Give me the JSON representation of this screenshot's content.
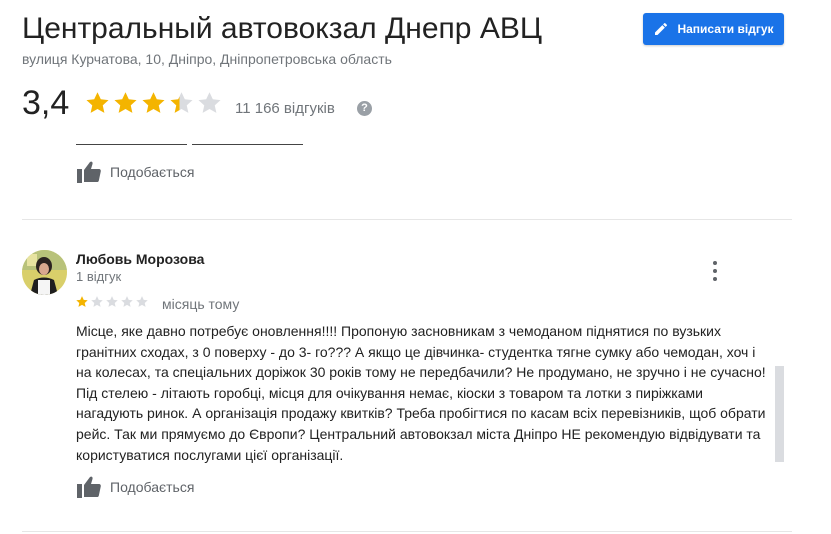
{
  "place": {
    "title": "Центральный автовокзал Днепр АВЦ",
    "address": "вулиця Курчатова, 10, Дніпро, Дніпропетровська область",
    "rating": "3,4",
    "rating_value": 3.4,
    "review_count": "11 166 відгуків",
    "help_icon": "?"
  },
  "actions": {
    "write_review_label": "Написати відгук",
    "write_review_icon": "pencil-icon"
  },
  "prev_review": {
    "like_label": "Подобається"
  },
  "review": {
    "author": "Любовь Морозова",
    "author_reviews": "1 відгук",
    "rating_value": 1,
    "date": "місяць тому",
    "text": "Місце, яке давно потребує оновлення!!!! Пропоную засновникам  з чемоданом піднятися по вузьких гранітних сходах, з 0 поверху - до 3- го??? А якщо це дівчинка- студентка тягне сумку або чемодан, хоч і на колесах, та спеціальних доріжок 30 років тому не передбачили?  Не продумано, не зручно і не сучасно! Під стелею - літають горобці,  місця для очікування немає,  кіоски з товаром та лотки з пиріжками нагадують ринок.  А організація продажу квитків? Треба пробігтися по касам всіх перевізників, щоб  обрати рейс. Так ми прямуємо до Європи? Центральний автовокзал міста Дніпро НЕ рекомендую відвідувати та користуватися послугами цієї організації.",
    "like_label": "Подобається"
  },
  "colors": {
    "star_filled": "#f4b400",
    "star_empty": "#dadce0",
    "accent": "#1a73e8",
    "secondary_text": "#70757a"
  }
}
